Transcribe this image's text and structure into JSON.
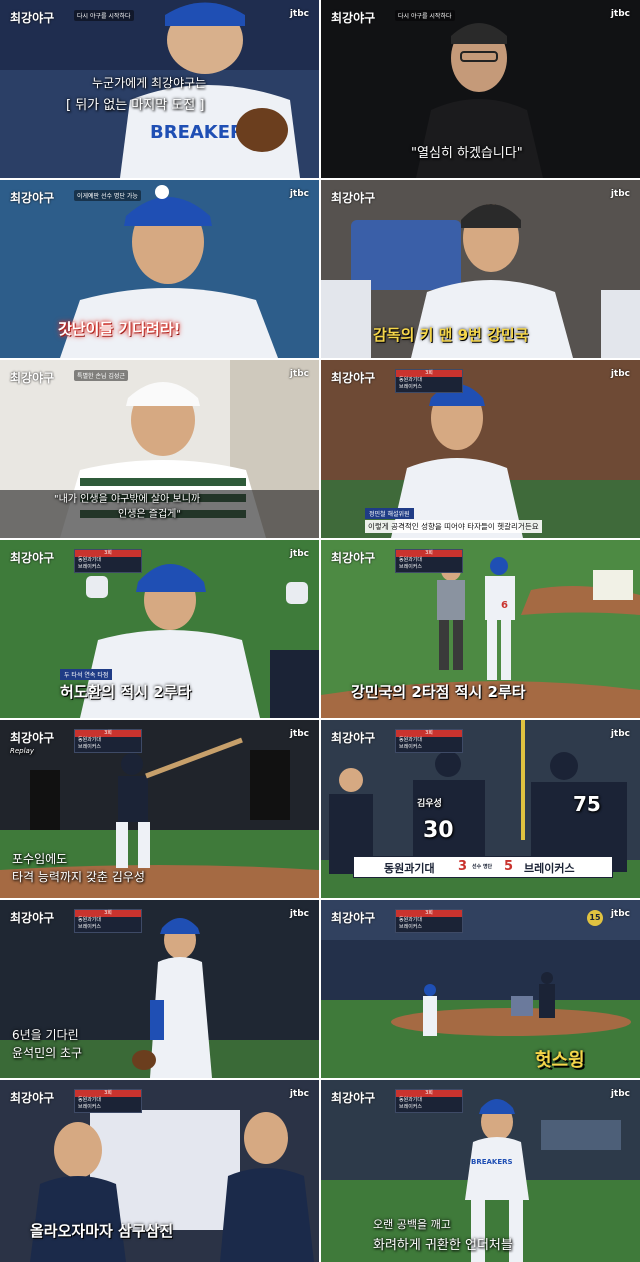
{
  "show_logo": "최강야구",
  "channel": "jtbc",
  "panels": [
    {
      "tag": "다시 야구를 시작하다",
      "captions": [
        "누군가에게 최강야구는",
        "[ 뒤가 없는 마지막 도전 ]"
      ],
      "jersey": "BREAKERS"
    },
    {
      "tag": "다시 야구를 시작하다",
      "captions": [
        "\"열심히 하겠습니다\""
      ]
    },
    {
      "tag": "이게예판 선수 명단 가능",
      "captions": [
        "갓난이들 기다려라!"
      ]
    },
    {
      "tag": "",
      "captions": [
        "감독의 키 맨 9번 강민국"
      ]
    },
    {
      "tag": "특별한 손님 김성근",
      "captions": [
        "\"내가 인생을 야구밖에 살아 보니까",
        "인생은 즐겁게\""
      ]
    },
    {
      "tag": "",
      "captions": [
        "정민철 해설위원",
        "이렇게 공격적인 성향을 띠어야 타자들이 헷갈리거든요"
      ]
    },
    {
      "tag": "두 타석 연속 타점",
      "captions": [
        "허도환의 적시 2루타"
      ]
    },
    {
      "tag": "",
      "captions": [
        "강민국의 2타점 적시 2루타"
      ],
      "number": "6"
    },
    {
      "tag": "Replay",
      "captions": [
        "포수임에도",
        "타격 능력까지 갖춘 김우성"
      ]
    },
    {
      "tag": "",
      "captions": [
        "동원과기대",
        "3",
        "선수 명단",
        "5",
        "브레이커스"
      ],
      "jersey_name": "김우성",
      "jersey_number": "30",
      "number_2": "75"
    },
    {
      "tag": "",
      "captions": [
        "6년을 기다린",
        "윤석민의 초구"
      ]
    },
    {
      "tag": "",
      "captions": [
        "헛스윙"
      ],
      "count": "15"
    },
    {
      "tag": "",
      "captions": [
        "올라오자마자 삼구삼진"
      ]
    },
    {
      "tag": "",
      "captions": [
        "오랜 공백을 깨고",
        "화려하게 귀환한 언더처블"
      ],
      "jersey": "BREAKERS"
    }
  ],
  "scoreboard": {
    "header": "3회",
    "team_a": "동원과기대",
    "team_b": "브레이커스"
  },
  "colors": {
    "breakers_blue": "#1f4fb4",
    "dark_navy": "#1b2336",
    "field_green": "#3f7a3a",
    "dirt": "#a56a43",
    "caption_yellow": "#f5d64a",
    "caption_red": "#e0362c"
  }
}
